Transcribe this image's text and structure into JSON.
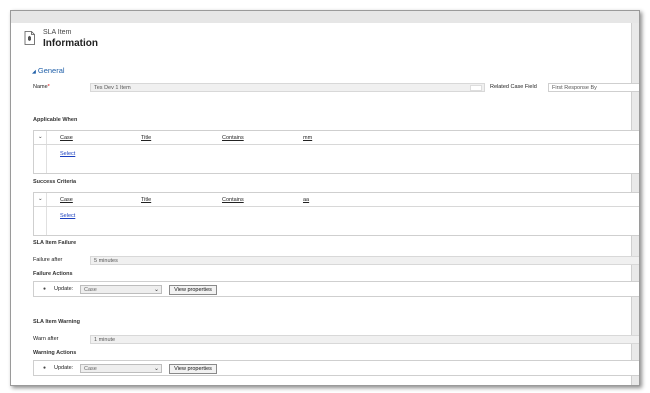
{
  "header": {
    "entity_type": "SLA Item",
    "form_title": "Information"
  },
  "section": {
    "label": "General"
  },
  "fields": {
    "name_label": "Name",
    "name_required_marker": "*",
    "name_value": "Tes Dev 1 Item",
    "related_case_field_label": "Related Case Field",
    "related_case_field_value": "First Response By"
  },
  "applicable_when": {
    "label": "Applicable When",
    "columns": [
      "Case",
      "Title",
      "Contains",
      "mm"
    ],
    "select_link": "Select"
  },
  "success_criteria": {
    "label": "Success Criteria",
    "columns": [
      "Case",
      "Title",
      "Contains",
      "aa"
    ],
    "select_link": "Select"
  },
  "failure": {
    "section_label": "SLA Item Failure",
    "after_label": "Failure after",
    "after_value": "5 minutes",
    "actions_label": "Failure Actions",
    "update_label": "Update:",
    "update_value": "Case",
    "view_properties": "View properties"
  },
  "warning": {
    "section_label": "SLA Item Warning",
    "after_label": "Warn after",
    "after_value": "1 minute",
    "actions_label": "Warning Actions",
    "update_label": "Update:",
    "update_value": "Case",
    "view_properties": "View properties"
  },
  "colors": {
    "link": "#1a3fbf",
    "section_header": "#1f5fa8",
    "required": "#dd0000",
    "field_bg": "#f0f0f0"
  },
  "icons": {
    "entity": "document-icon",
    "expand": "triangle-down-icon",
    "grid_expand": "chevron-down-icon",
    "dropdown": "chevron-down-icon",
    "bullet": "bullet-icon"
  }
}
